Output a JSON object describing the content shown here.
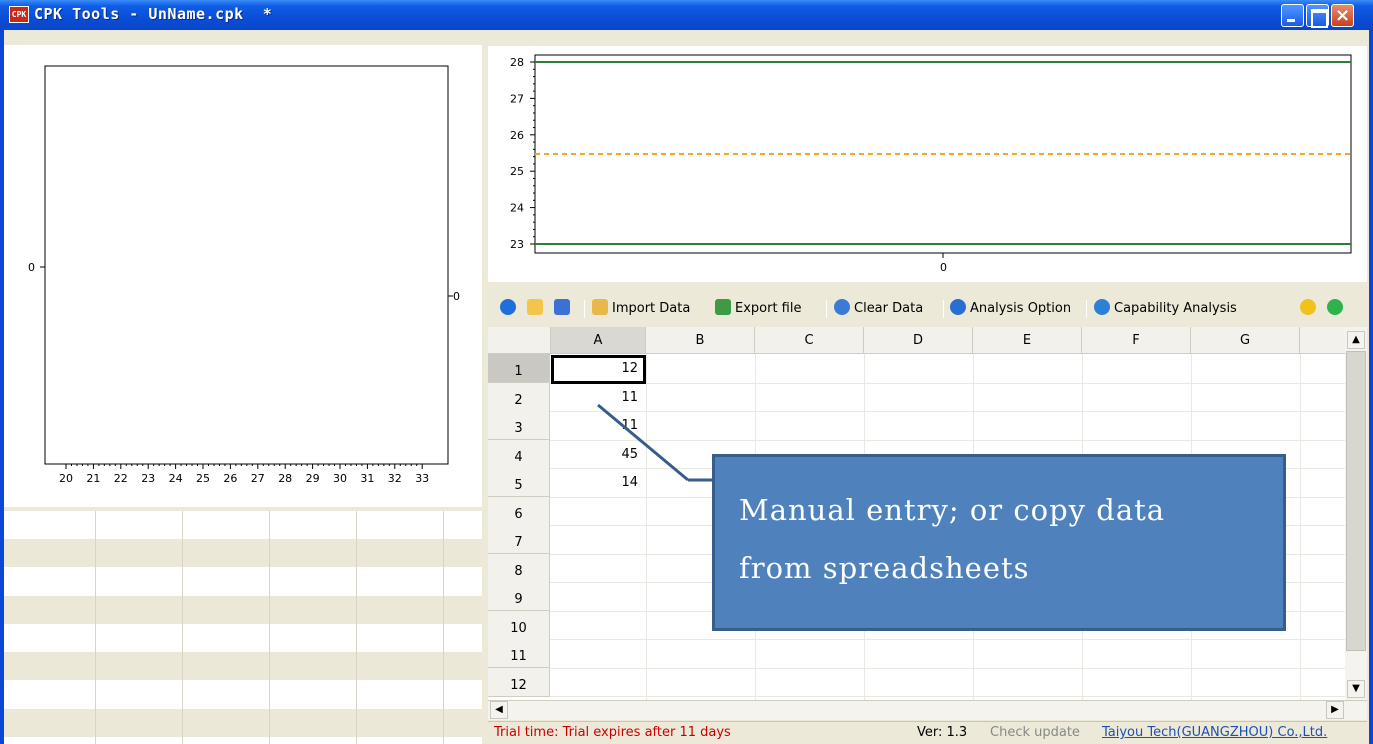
{
  "window": {
    "title": "CPK Tools - UnName.cpk  *",
    "app_icon_label": "CPK",
    "close_glyph": "×"
  },
  "left_chart": {
    "x_ticks": [
      "20",
      "21",
      "22",
      "23",
      "24",
      "25",
      "26",
      "27",
      "28",
      "29",
      "30",
      "31",
      "32",
      "33"
    ],
    "y_left_label": "0",
    "y_right_label": "0"
  },
  "top_chart": {
    "y_ticks": [
      "28",
      "27",
      "26",
      "25",
      "24",
      "23"
    ],
    "x_tick": "0"
  },
  "toolbar": {
    "import_label": "Import Data",
    "export_label": "Export file",
    "clear_label": "Clear Data",
    "option_label": "Analysis Option",
    "analysis_label": "Capability Analysis"
  },
  "grid": {
    "columns": [
      "A",
      "B",
      "C",
      "D",
      "E",
      "F",
      "G"
    ],
    "rows": [
      "1",
      "2",
      "3",
      "4",
      "5",
      "6",
      "7",
      "8",
      "9",
      "10",
      "11",
      "12"
    ],
    "values_a": [
      "12",
      "11",
      "11",
      "45",
      "14"
    ]
  },
  "callout": {
    "line1": "Manual entry; or copy data",
    "line2": "from spreadsheets"
  },
  "status": {
    "trial": "Trial time: Trial expires after 11 days",
    "version": "Ver: 1.3",
    "check_update": "Check update",
    "company": "Taiyou Tech(GUANGZHOU) Co.,Ltd."
  },
  "colors": {
    "title_bar": "#0a4ed6",
    "spec_limit_line": "#2e7d32",
    "center_line": "#f5a623",
    "callout_fill": "#4f81bd",
    "trial_text": "#cc0000",
    "link_text": "#1f4fb0"
  }
}
